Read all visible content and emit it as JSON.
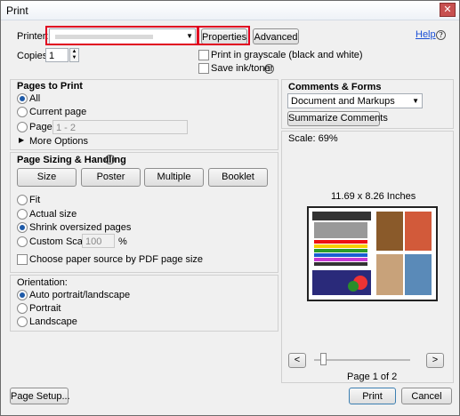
{
  "window": {
    "title": "Print",
    "close_label": "✕"
  },
  "top": {
    "printer_label": "Printer:",
    "printer_value": "",
    "properties_label": "Properties",
    "advanced_label": "Advanced",
    "help_label": "Help",
    "copies_label": "Copies:",
    "copies_value": "1",
    "grayscale_label": "Print in grayscale (black and white)",
    "save_ink_label": "Save ink/toner"
  },
  "pages_to_print": {
    "title": "Pages to Print",
    "all_label": "All",
    "current_label": "Current page",
    "pages_label": "Pages",
    "pages_value": "1 - 2",
    "more_label": "More Options"
  },
  "sizing": {
    "title": "Page Sizing & Handling",
    "buttons": [
      "Size",
      "Poster",
      "Multiple",
      "Booklet"
    ],
    "fit_label": "Fit",
    "actual_label": "Actual size",
    "shrink_label": "Shrink oversized pages",
    "custom_label": "Custom Scale:",
    "custom_value": "100",
    "percent": "%",
    "choose_source_label": "Choose paper source by PDF page size"
  },
  "orientation": {
    "title": "Orientation:",
    "auto_label": "Auto portrait/landscape",
    "portrait_label": "Portrait",
    "landscape_label": "Landscape"
  },
  "comments": {
    "title": "Comments & Forms",
    "select_value": "Document and Markups",
    "summarize_label": "Summarize Comments",
    "scale_text": "Scale:  69%"
  },
  "preview": {
    "size_text": "11.69 x 8.26 Inches",
    "page_text": "Page 1 of 2",
    "prev_label": "<",
    "next_label": ">"
  },
  "bottom": {
    "page_setup_label": "Page Setup...",
    "print_label": "Print",
    "cancel_label": "Cancel"
  },
  "colors": {
    "highlight": "#e00020",
    "link": "#1a4fd6"
  }
}
